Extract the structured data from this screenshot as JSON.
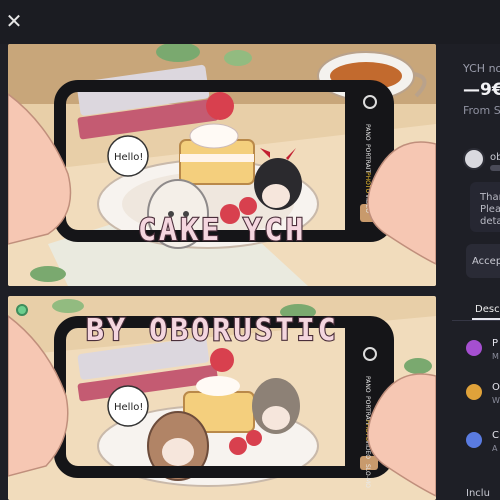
{
  "header": {
    "close_symbol": "✕"
  },
  "gallery": {
    "image1_watermark": "CAKE YCH",
    "image2_watermark": "BY OBORUSTIC",
    "speech_bubble_1": "Hello!",
    "speech_bubble_2": "Hello!",
    "camera_modes": [
      "PANO",
      "PORTRAIT",
      "PHOTO",
      "VIDEO",
      "SLO-MO"
    ]
  },
  "sidebar": {
    "title": "YCH no",
    "price": "—9€",
    "from": "From S",
    "username": "ob",
    "message": [
      "Than",
      "Pleas",
      "detai"
    ],
    "accept": "Accep",
    "tab_description": "Descri",
    "features": [
      {
        "title": "P",
        "sub": "M",
        "color": "#a54fd0"
      },
      {
        "title": "O",
        "sub": "W",
        "color": "#e0a23a"
      },
      {
        "title": "C",
        "sub": "A",
        "color": "#5a7be0"
      }
    ],
    "includes": "Inclu"
  }
}
